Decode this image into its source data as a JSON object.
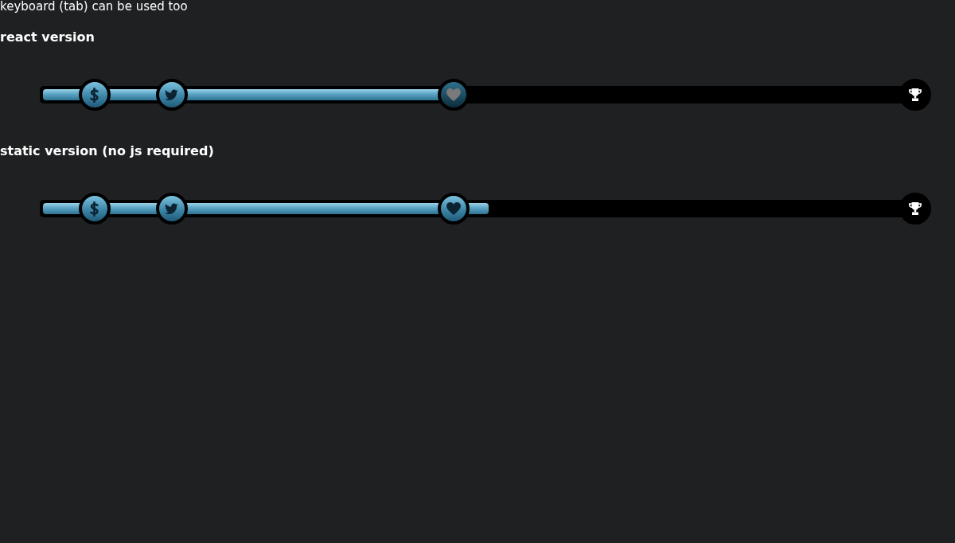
{
  "note": {
    "text": "keyboard (tab) can be used too"
  },
  "sections": [
    {
      "heading": "react version",
      "progress": {
        "level": 0.4727
      },
      "milestones": [
        {
          "kind": "dollar",
          "level": 0.0627,
          "reached": true
        },
        {
          "kind": "bird",
          "level": 0.1509,
          "reached": true
        },
        {
          "kind": "heart",
          "level": 0.4727,
          "reached": false
        },
        {
          "kind": "trophy",
          "level": 1,
          "reached": false
        }
      ]
    },
    {
      "heading": "static version (no js required)",
      "progress": {
        "level": 0.5127
      },
      "milestones": [
        {
          "kind": "dollar",
          "level": 0.0627,
          "reached": true
        },
        {
          "kind": "bird",
          "level": 0.1509,
          "reached": true
        },
        {
          "kind": "heart",
          "level": 0.4727,
          "reached": true
        },
        {
          "kind": "trophy",
          "level": 1,
          "reached": false
        }
      ]
    }
  ]
}
